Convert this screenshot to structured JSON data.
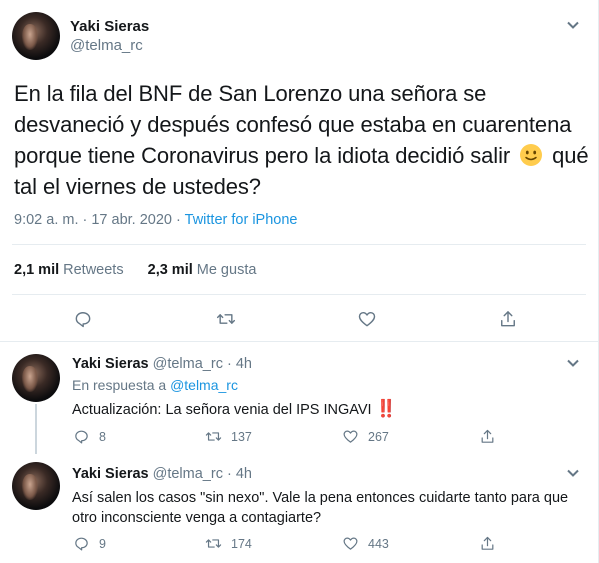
{
  "main_tweet": {
    "name": "Yaki Sieras",
    "handle": "@telma_rc",
    "text_before_emoji": "En la fila del BNF de San Lorenzo una señora se desvaneció y después confesó que estaba en cuarentena porque tiene Coronavirus pero la idiota decidió salir",
    "emoji": "slightly-smiling-face",
    "text_after_emoji": "qué tal el viernes de ustedes?",
    "timestamp": "9:02 a. m. · 17 abr. 2020 ·",
    "source": "Twitter for iPhone",
    "retweets_count": "2,1 mil",
    "retweets_label": "Retweets",
    "likes_count": "2,3 mil",
    "likes_label": "Me gusta"
  },
  "replies": [
    {
      "name": "Yaki Sieras",
      "handle": "@telma_rc · 4h",
      "in_reply_prefix": "En respuesta a",
      "in_reply_handle": "@telma_rc",
      "text": "Actualización: La señora venia del IPS INGAVI",
      "emoji": "double-exclamation",
      "emoji_text": "‼️",
      "replies_count": "8",
      "retweets_count": "137",
      "likes_count": "267"
    },
    {
      "name": "Yaki Sieras",
      "handle": "@telma_rc · 4h",
      "text": "Así salen los casos \"sin nexo\". Vale la pena entonces cuidarte tanto para que otro inconsciente venga a contagiarte?",
      "replies_count": "9",
      "retweets_count": "174",
      "likes_count": "443"
    }
  ],
  "colors": {
    "text": "#14171a",
    "secondary": "#657786",
    "link": "#1b95e0",
    "divider": "#e6ecf0"
  }
}
